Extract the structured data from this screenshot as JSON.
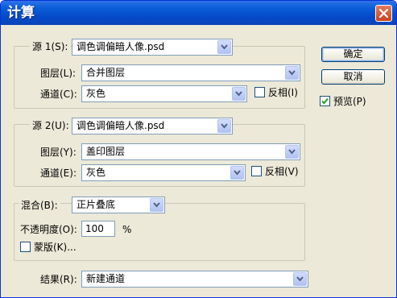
{
  "window": {
    "title": "计算"
  },
  "source1": {
    "label": "源 1(S):",
    "file": "调色调偏暗人像.psd",
    "layer_label": "图层(L):",
    "layer_value": "合并图层",
    "channel_label": "通道(C):",
    "channel_value": "灰色",
    "invert_label": "反相(I)",
    "invert_checked": false
  },
  "source2": {
    "label": "源 2(U):",
    "file": "调色调偏暗人像.psd",
    "layer_label": "图层(Y):",
    "layer_value": "盖印图层",
    "channel_label": "通道(E):",
    "channel_value": "灰色",
    "invert_label": "反相(V)",
    "invert_checked": false
  },
  "blending": {
    "label": "混合(B):",
    "mode": "正片叠底",
    "opacity_label": "不透明度(O):",
    "opacity_value": "100",
    "opacity_unit": "%",
    "mask_label": "蒙版(K)...",
    "mask_checked": false
  },
  "result": {
    "label": "结果(R):",
    "value": "新建通道"
  },
  "buttons": {
    "ok": "确定",
    "cancel": "取消"
  },
  "preview": {
    "label": "预览(P)",
    "checked": true
  }
}
